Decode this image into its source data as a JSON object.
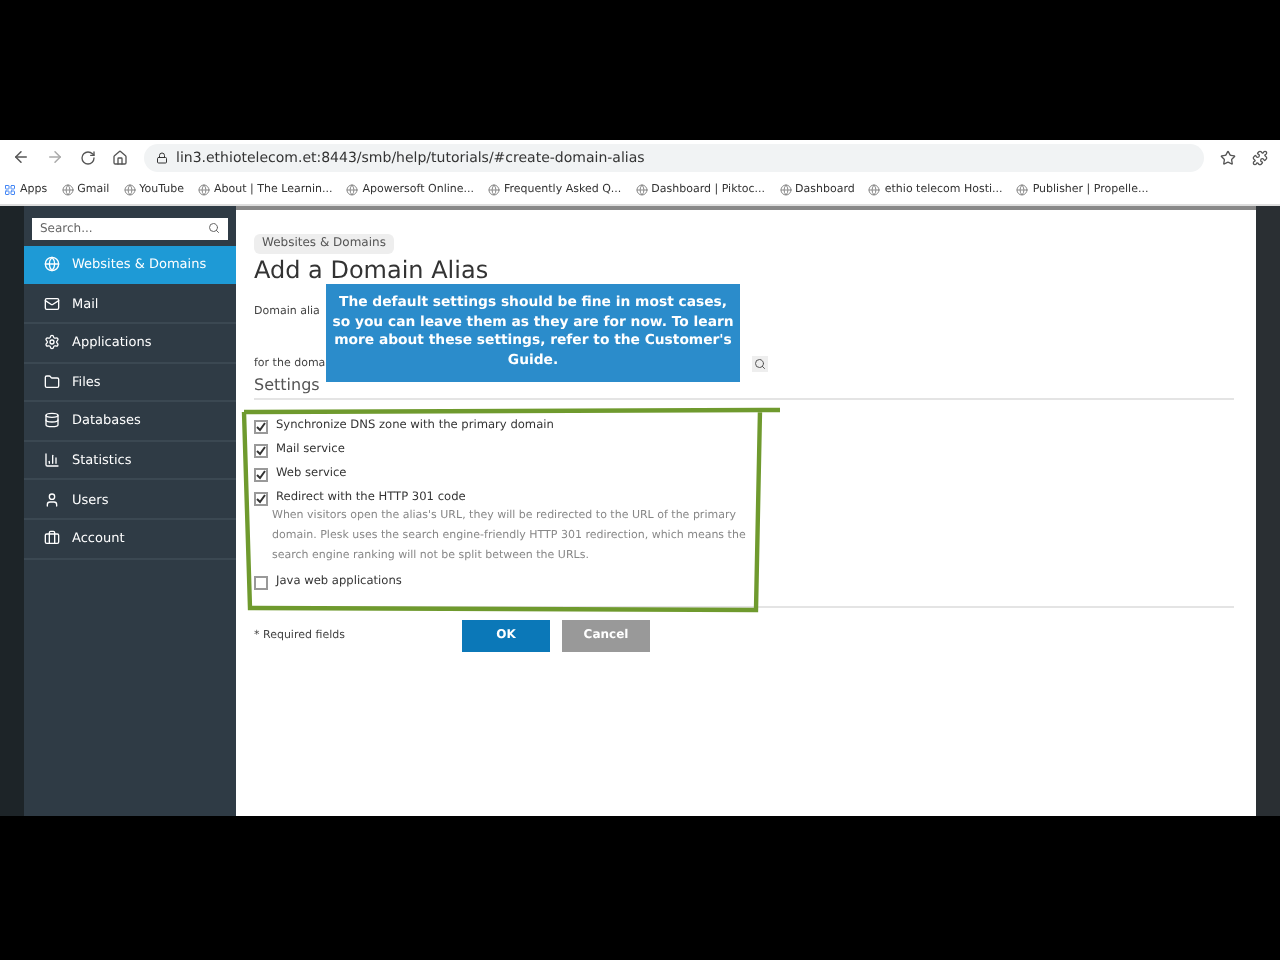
{
  "browser": {
    "url": "lin3.ethiotelecom.et:8443/smb/help/tutorials/#create-domain-alias",
    "bookmarks": [
      {
        "label": "Apps"
      },
      {
        "label": "Gmail"
      },
      {
        "label": "YouTube"
      },
      {
        "label": "About | The Learnin..."
      },
      {
        "label": "Apowersoft Online..."
      },
      {
        "label": "Frequently Asked Q..."
      },
      {
        "label": "Dashboard | Piktoc..."
      },
      {
        "label": "Dashboard"
      },
      {
        "label": "ethio telecom Hosti..."
      },
      {
        "label": "Publisher | Propelle..."
      }
    ]
  },
  "sidebar": {
    "search_placeholder": "Search...",
    "items": [
      {
        "label": "Websites & Domains",
        "selected": true
      },
      {
        "label": "Mail",
        "selected": false
      },
      {
        "label": "Applications",
        "selected": false
      },
      {
        "label": "Files",
        "selected": false
      },
      {
        "label": "Databases",
        "selected": false
      },
      {
        "label": "Statistics",
        "selected": false
      },
      {
        "label": "Users",
        "selected": false
      },
      {
        "label": "Account",
        "selected": false
      }
    ]
  },
  "main": {
    "breadcrumb": "Websites & Domains",
    "title": "Add a Domain Alias",
    "field_label": "Domain alia",
    "field_label_2": "for the doma",
    "section": "Settings",
    "options": [
      {
        "label": "Synchronize DNS zone with the primary domain",
        "checked": true
      },
      {
        "label": "Mail service",
        "checked": true
      },
      {
        "label": "Web service",
        "checked": true
      },
      {
        "label": "Redirect with the HTTP 301 code",
        "checked": true,
        "description": "When visitors open the alias's URL, they will be redirected to the URL of the primary domain. Plesk uses the search engine-friendly HTTP 301 redirection, which means the search engine ranking will not be split between the URLs."
      },
      {
        "label": "Java web applications",
        "checked": false
      }
    ],
    "required_note": "* Required fields",
    "buttons": [
      {
        "label": "OK",
        "kind": "primary"
      },
      {
        "label": "Cancel",
        "kind": "secondary"
      }
    ]
  },
  "tooltip": "The default settings should be fine in most cases, so you can leave them as they are for now. To learn more about these settings, refer to the Customer's Guide."
}
